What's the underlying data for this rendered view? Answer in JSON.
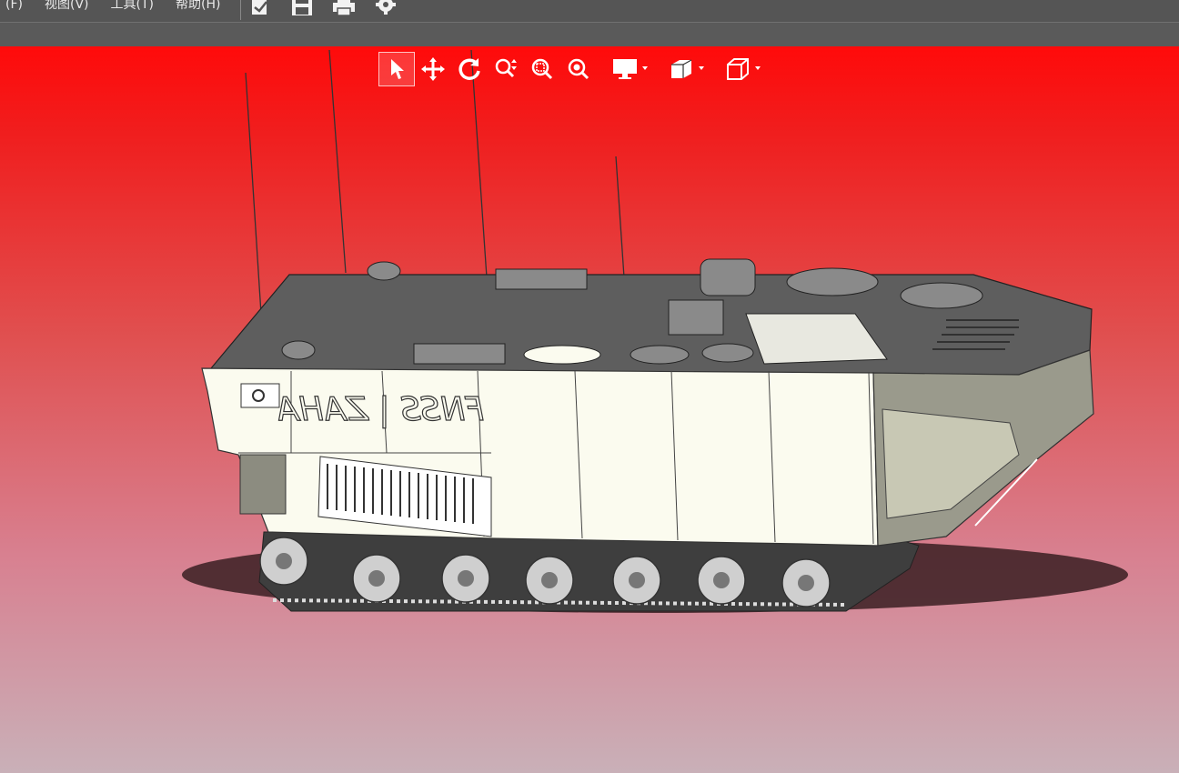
{
  "menu": {
    "items": [
      {
        "label": "(F)"
      },
      {
        "label": "视图(V)"
      },
      {
        "label": "工具(T)"
      },
      {
        "label": "帮助(H)"
      }
    ]
  },
  "quick_access": [
    {
      "icon": "open-document-icon"
    },
    {
      "icon": "save-icon"
    },
    {
      "icon": "print-icon"
    },
    {
      "icon": "gear-icon"
    }
  ],
  "view_toolbar": [
    {
      "icon": "select-arrow-icon",
      "active": true
    },
    {
      "icon": "pan-move-icon"
    },
    {
      "icon": "rotate-icon"
    },
    {
      "icon": "zoom-up-down-icon"
    },
    {
      "icon": "zoom-window-icon"
    },
    {
      "icon": "zoom-fit-icon"
    },
    {
      "icon": "display-monitor-icon",
      "dropdown": true
    },
    {
      "icon": "section-view-icon",
      "dropdown": true
    },
    {
      "icon": "cube-view-icon",
      "dropdown": true
    }
  ],
  "model": {
    "hull_lettering": "FNSS | ZAHA",
    "colors": {
      "viewport_top": "#ff0a0a",
      "viewport_bottom": "#c9b0b8",
      "hull_side": "#fbfbef",
      "hull_top": "#5e5e5e",
      "track": "#3a3a3a"
    }
  },
  "colors": {
    "menubar_bg": "#555555",
    "menu_text": "#e8e8e8",
    "toolbar_icon": "#ffffff"
  }
}
